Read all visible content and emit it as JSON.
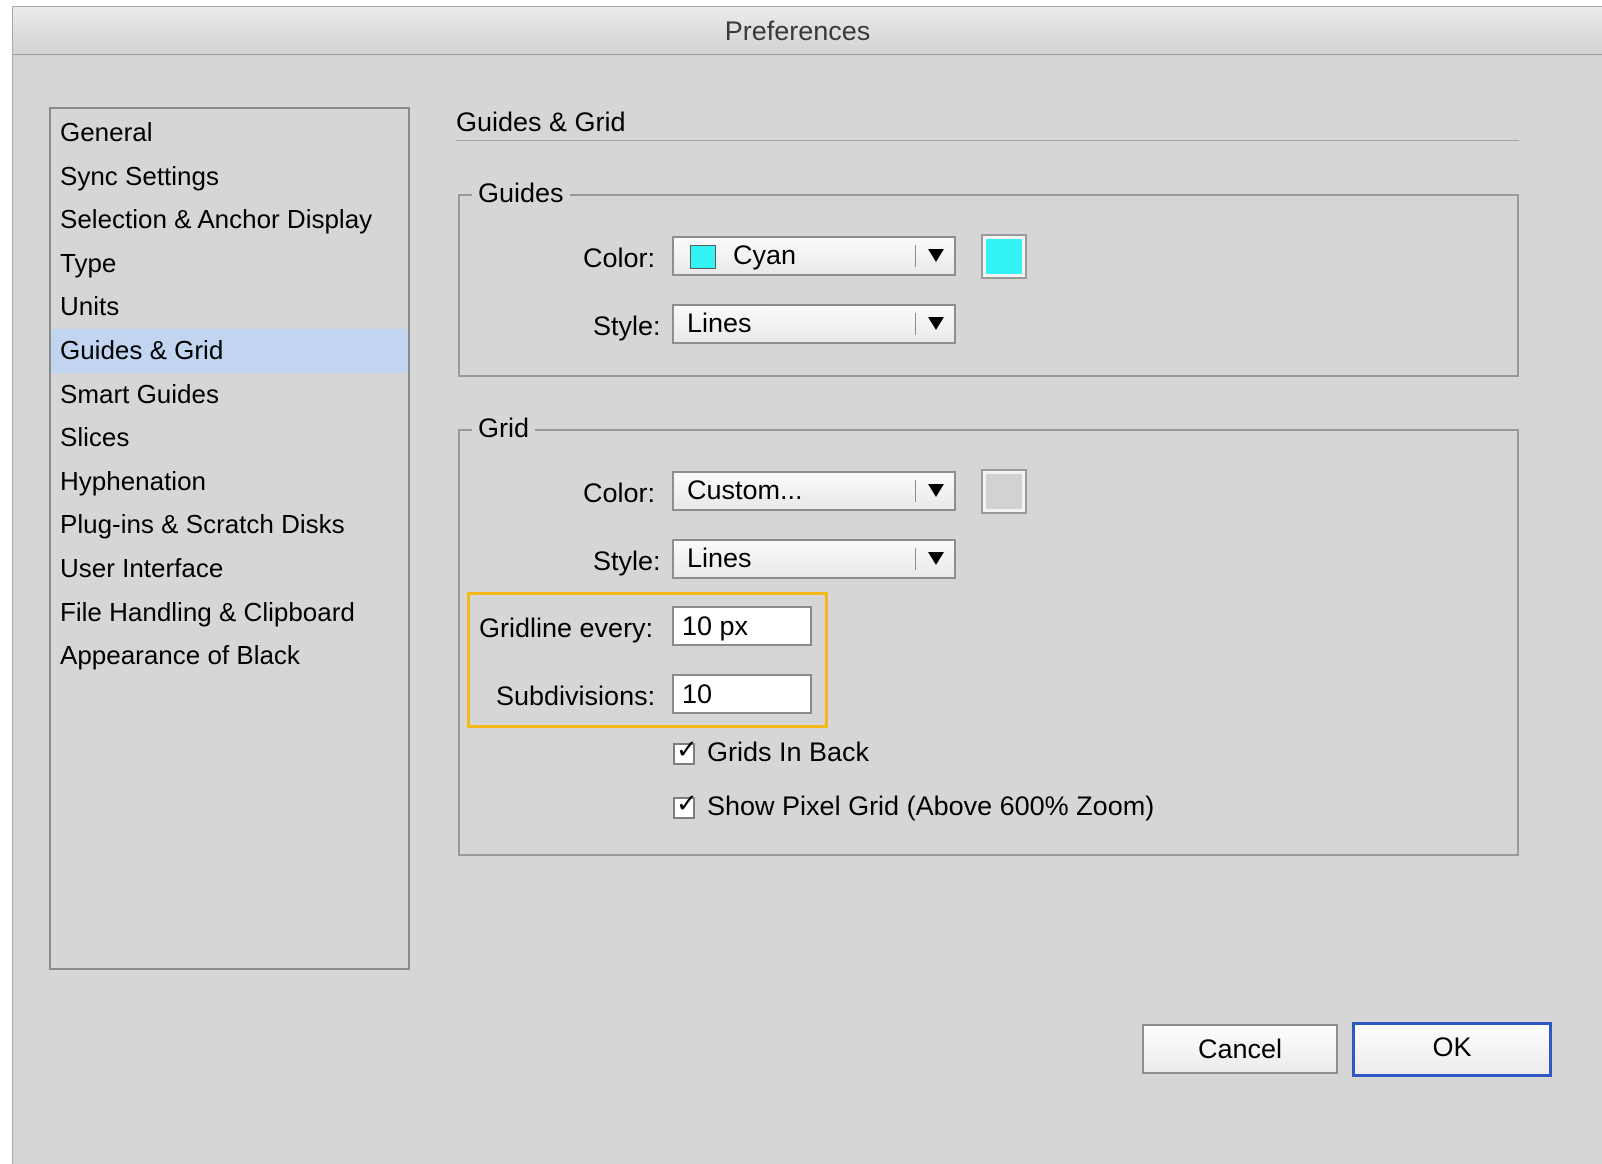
{
  "window": {
    "title": "Preferences"
  },
  "sidebar": {
    "items": [
      {
        "label": "General"
      },
      {
        "label": "Sync Settings"
      },
      {
        "label": "Selection & Anchor Display"
      },
      {
        "label": "Type"
      },
      {
        "label": "Units"
      },
      {
        "label": "Guides & Grid",
        "selected": true
      },
      {
        "label": "Smart Guides"
      },
      {
        "label": "Slices"
      },
      {
        "label": "Hyphenation"
      },
      {
        "label": "Plug-ins & Scratch Disks"
      },
      {
        "label": "User Interface"
      },
      {
        "label": "File Handling & Clipboard"
      },
      {
        "label": "Appearance of Black"
      }
    ]
  },
  "main": {
    "heading": "Guides & Grid",
    "guides": {
      "legend": "Guides",
      "color_label": "Color:",
      "color_value": "Cyan",
      "color_hex": "#33f3f7",
      "style_label": "Style:",
      "style_value": "Lines"
    },
    "grid": {
      "legend": "Grid",
      "color_label": "Color:",
      "color_value": "Custom...",
      "color_hex": "#d2d2d2",
      "style_label": "Style:",
      "style_value": "Lines",
      "gridline_label": "Gridline every:",
      "gridline_value": "10 px",
      "subdivisions_label": "Subdivisions:",
      "subdivisions_value": "10",
      "grids_in_back_label": "Grids In Back",
      "grids_in_back_checked": true,
      "pixel_grid_label": "Show Pixel Grid (Above 600% Zoom)",
      "pixel_grid_checked": true
    }
  },
  "buttons": {
    "cancel": "Cancel",
    "ok": "OK"
  },
  "colors": {
    "highlight": "#f5b81b",
    "selection": "#c1d4f0",
    "default_button_border": "#2f58c4"
  },
  "icons": {
    "dropdown_arrow": "triangle-down-icon",
    "checkmark": "checkmark-icon"
  }
}
